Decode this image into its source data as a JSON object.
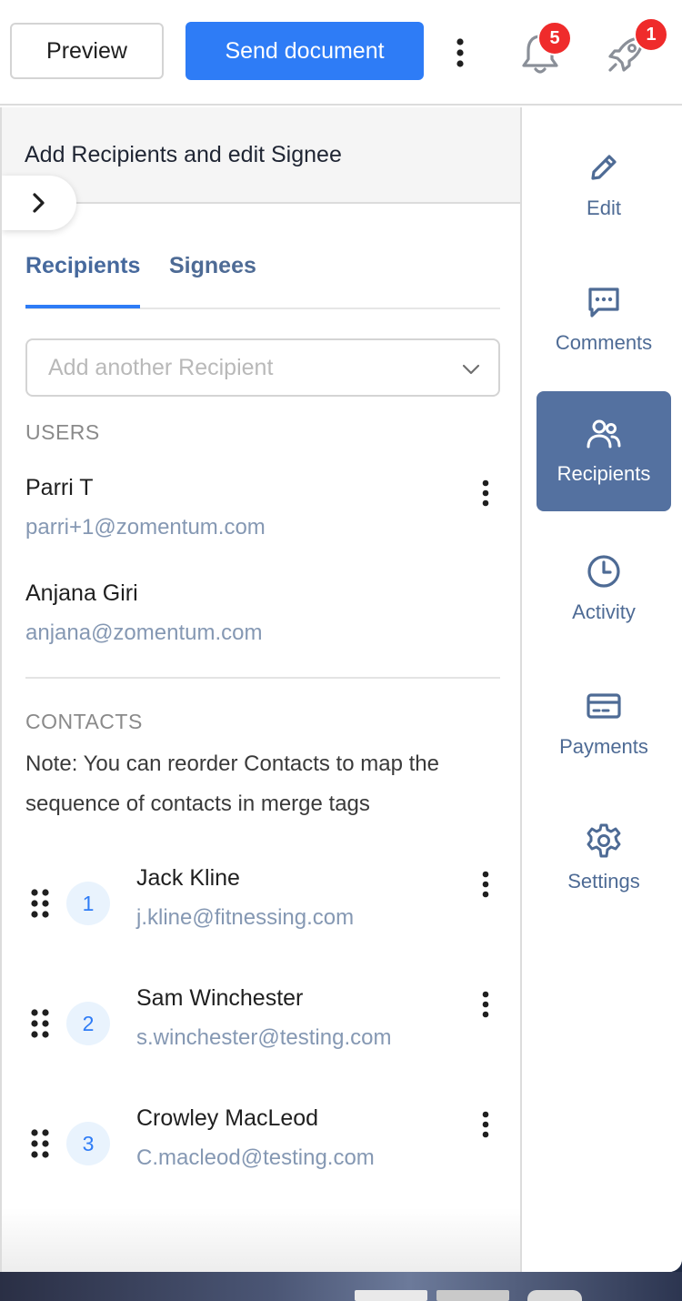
{
  "toolbar": {
    "preview_label": "Preview",
    "send_label": "Send document",
    "notifications_count": "5",
    "updates_count": "1"
  },
  "panel": {
    "title": "Add Recipients and edit Signee",
    "tabs": [
      {
        "label": "Recipients",
        "active": true
      },
      {
        "label": "Signees",
        "active": false
      }
    ],
    "add_placeholder": "Add another Recipient",
    "users_heading": "USERS",
    "users": [
      {
        "name": "Parri T",
        "email": "parri+1@zomentum.com"
      },
      {
        "name": "Anjana Giri",
        "email": "anjana@zomentum.com"
      }
    ],
    "contacts_heading": "CONTACTS",
    "contacts_note": "Note: You can reorder Contacts to map the sequence of contacts in merge tags",
    "contacts": [
      {
        "order": "1",
        "name": "Jack Kline",
        "email": "j.kline@fitnessing.com"
      },
      {
        "order": "2",
        "name": "Sam Winchester",
        "email": "s.winchester@testing.com"
      },
      {
        "order": "3",
        "name": "Crowley MacLeod",
        "email": "C.macleod@testing.com"
      }
    ]
  },
  "sidebar": {
    "items": [
      {
        "label": "Edit",
        "icon": "pencil-icon"
      },
      {
        "label": "Comments",
        "icon": "comment-icon"
      },
      {
        "label": "Recipients",
        "icon": "users-icon",
        "active": true
      },
      {
        "label": "Activity",
        "icon": "clock-icon"
      },
      {
        "label": "Payments",
        "icon": "card-icon"
      },
      {
        "label": "Settings",
        "icon": "gear-icon"
      }
    ]
  },
  "colors": {
    "primary": "#2e7cf6",
    "nav_active": "#5471a0",
    "nav_text": "#4e6b95",
    "badge": "#ef2b2b"
  }
}
